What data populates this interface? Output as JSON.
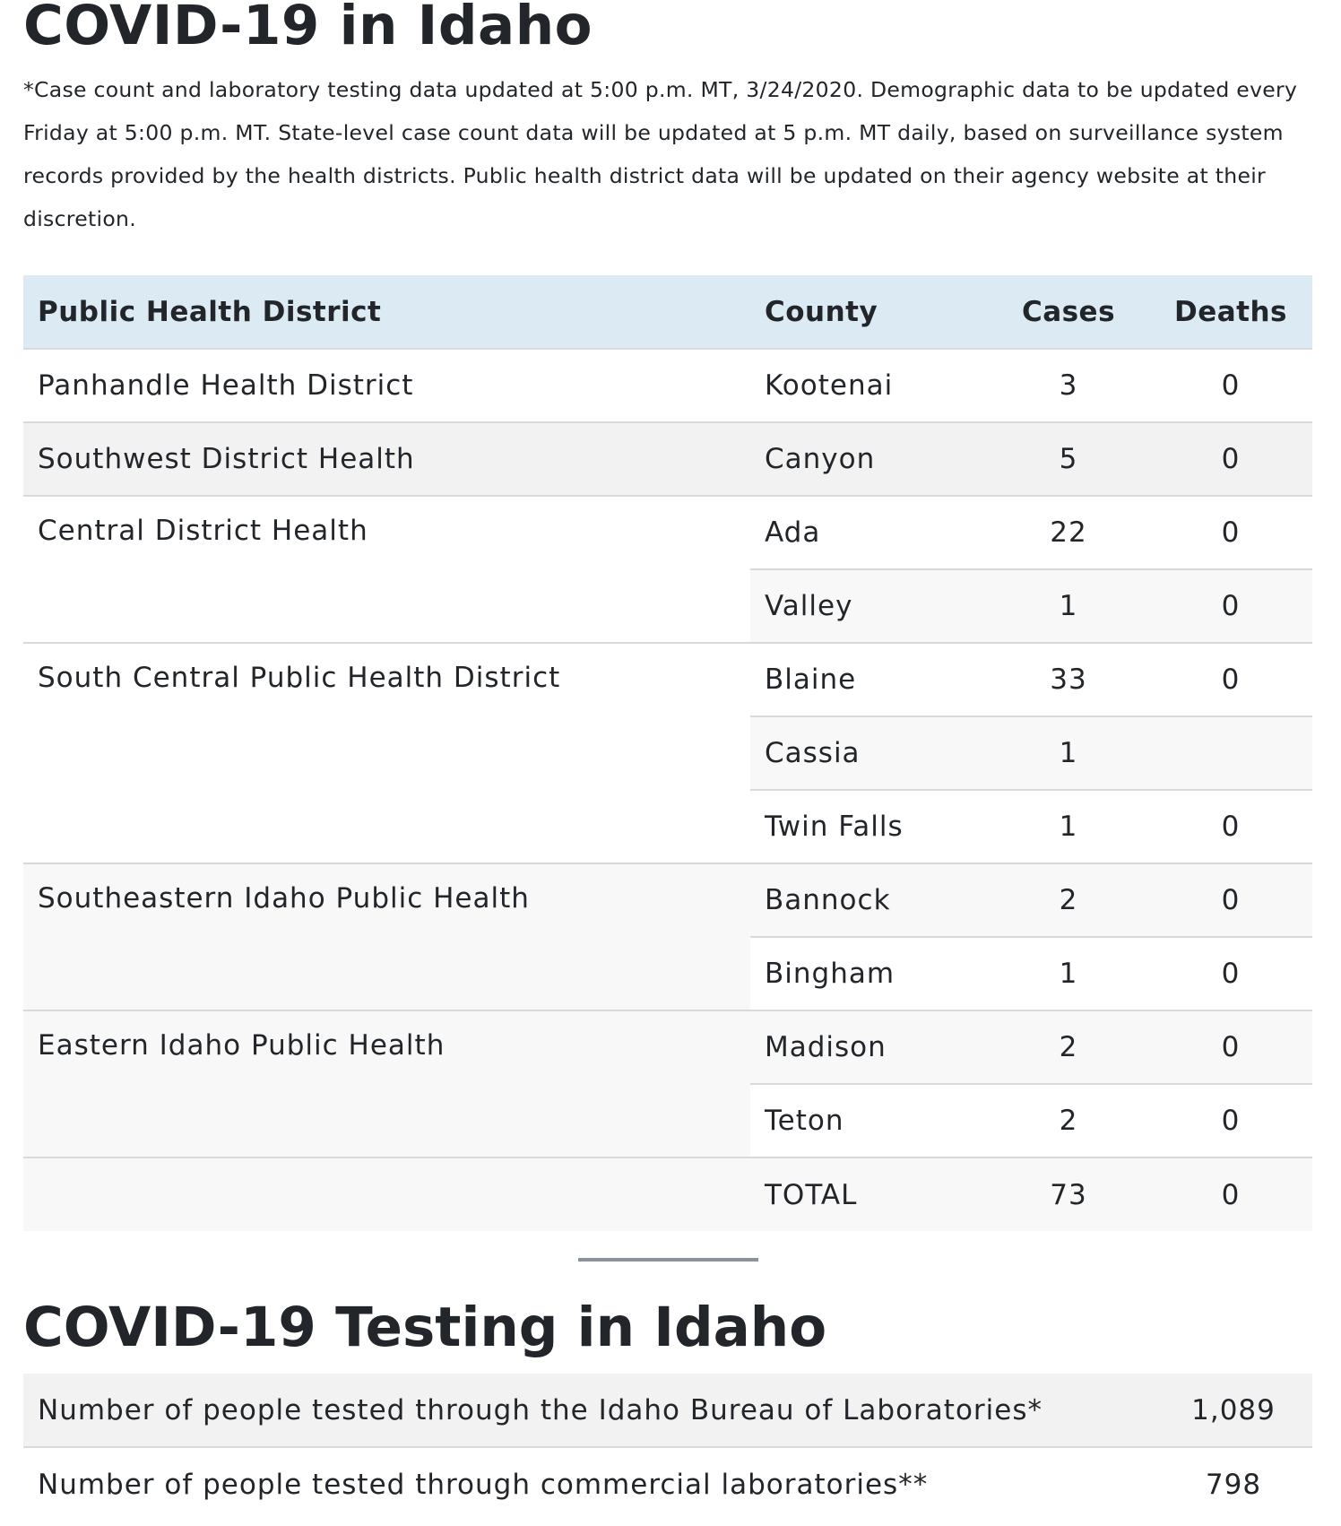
{
  "title": "COVID-19 in Idaho",
  "note": "*Case count and laboratory testing data updated at 5:00 p.m. MT, 3/24/2020. Demographic data to be updated every Friday at 5:00 p.m. MT. State-level case count data will be updated at 5 p.m. MT daily, based on surveillance system records provided by the health districts. Public health district data will be updated on their agency website at their discretion.",
  "cases_table": {
    "headers": {
      "district": "Public Health District",
      "county": "County",
      "cases": "Cases",
      "deaths": "Deaths"
    },
    "districts": [
      {
        "name": "Panhandle Health District",
        "rows": [
          {
            "county": "Kootenai",
            "cases": "3",
            "deaths": "0"
          }
        ]
      },
      {
        "name": "Southwest District Health",
        "rows": [
          {
            "county": "Canyon",
            "cases": "5",
            "deaths": "0"
          }
        ]
      },
      {
        "name": "Central District Health",
        "rows": [
          {
            "county": "Ada",
            "cases": "22",
            "deaths": "0"
          },
          {
            "county": "Valley",
            "cases": "1",
            "deaths": "0"
          }
        ]
      },
      {
        "name": "South Central Public Health District",
        "rows": [
          {
            "county": "Blaine",
            "cases": "33",
            "deaths": "0"
          },
          {
            "county": "Cassia",
            "cases": "1",
            "deaths": ""
          },
          {
            "county": "Twin Falls",
            "cases": "1",
            "deaths": "0"
          }
        ]
      },
      {
        "name": "Southeastern Idaho Public Health",
        "rows": [
          {
            "county": "Bannock",
            "cases": "2",
            "deaths": "0"
          },
          {
            "county": "Bingham",
            "cases": "1",
            "deaths": "0"
          }
        ]
      },
      {
        "name": "Eastern Idaho Public Health",
        "rows": [
          {
            "county": "Madison",
            "cases": "2",
            "deaths": "0"
          },
          {
            "county": "Teton",
            "cases": "2",
            "deaths": "0"
          }
        ]
      }
    ],
    "total": {
      "label": "TOTAL",
      "cases": "73",
      "deaths": "0"
    }
  },
  "testing_title": "COVID-19 Testing in Idaho",
  "testing_rows": [
    {
      "label": "Number of people tested through the Idaho Bureau of Laboratories*",
      "value": "1,089"
    },
    {
      "label": "Number of people tested through commercial laboratories**",
      "value": "798"
    }
  ],
  "colors": {
    "header_bg": "#dcebf3",
    "divider": "#8a929c",
    "row_grey": "#f2f2f2",
    "row_light": "#f8f8f8"
  }
}
